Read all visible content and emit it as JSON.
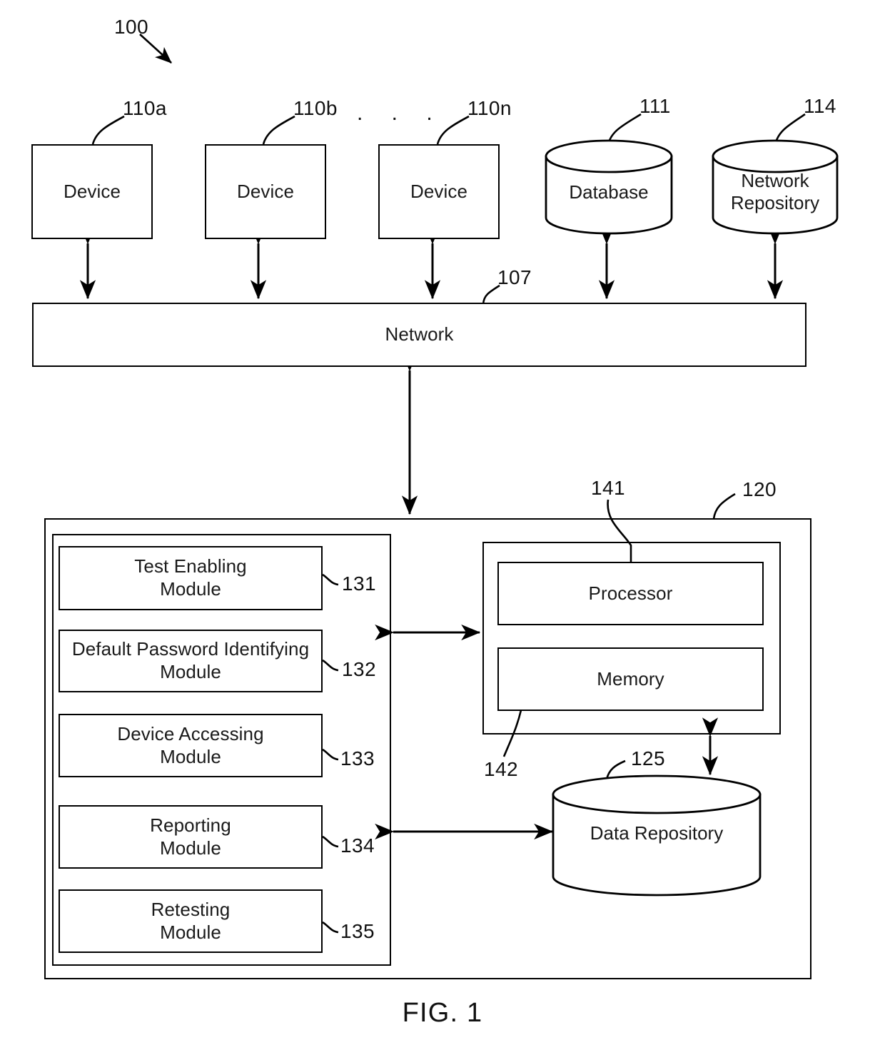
{
  "figure": {
    "caption": "FIG. 1",
    "system_ref": "100"
  },
  "top_row": {
    "devices": [
      {
        "label": "Device",
        "ref": "110a"
      },
      {
        "label": "Device",
        "ref": "110b"
      },
      {
        "label": "Device",
        "ref": "110n"
      }
    ],
    "ellipsis": ". . .",
    "stores": [
      {
        "label": "Database",
        "ref": "111"
      },
      {
        "label": "Network\nRepository",
        "ref": "114",
        "line1": "Network",
        "line2": "Repository"
      }
    ]
  },
  "network": {
    "label": "Network",
    "ref": "107"
  },
  "system": {
    "ref": "120",
    "modules_panel": {
      "modules": [
        {
          "label": "Test Enabling Module",
          "line1": "Test Enabling",
          "line2": "Module",
          "ref": "131"
        },
        {
          "label": "Default Password Identifying Module",
          "line1": "Default Password Identifying",
          "line2": "Module",
          "ref": "132"
        },
        {
          "label": "Device Accessing Module",
          "line1": "Device Accessing",
          "line2": "Module",
          "ref": "133"
        },
        {
          "label": "Reporting Module",
          "line1": "Reporting",
          "line2": "Module",
          "ref": "134"
        },
        {
          "label": "Retesting Module",
          "line1": "Retesting",
          "line2": "Module",
          "ref": "135"
        }
      ]
    },
    "compute_panel": {
      "ref": "142",
      "processor": {
        "label": "Processor",
        "ref": "141"
      },
      "memory": {
        "label": "Memory"
      }
    },
    "data_repository": {
      "label": "Data Repository",
      "ref": "125"
    }
  },
  "colors": {
    "stroke": "#000000",
    "background": "#ffffff",
    "text": "#1a1a1a"
  }
}
